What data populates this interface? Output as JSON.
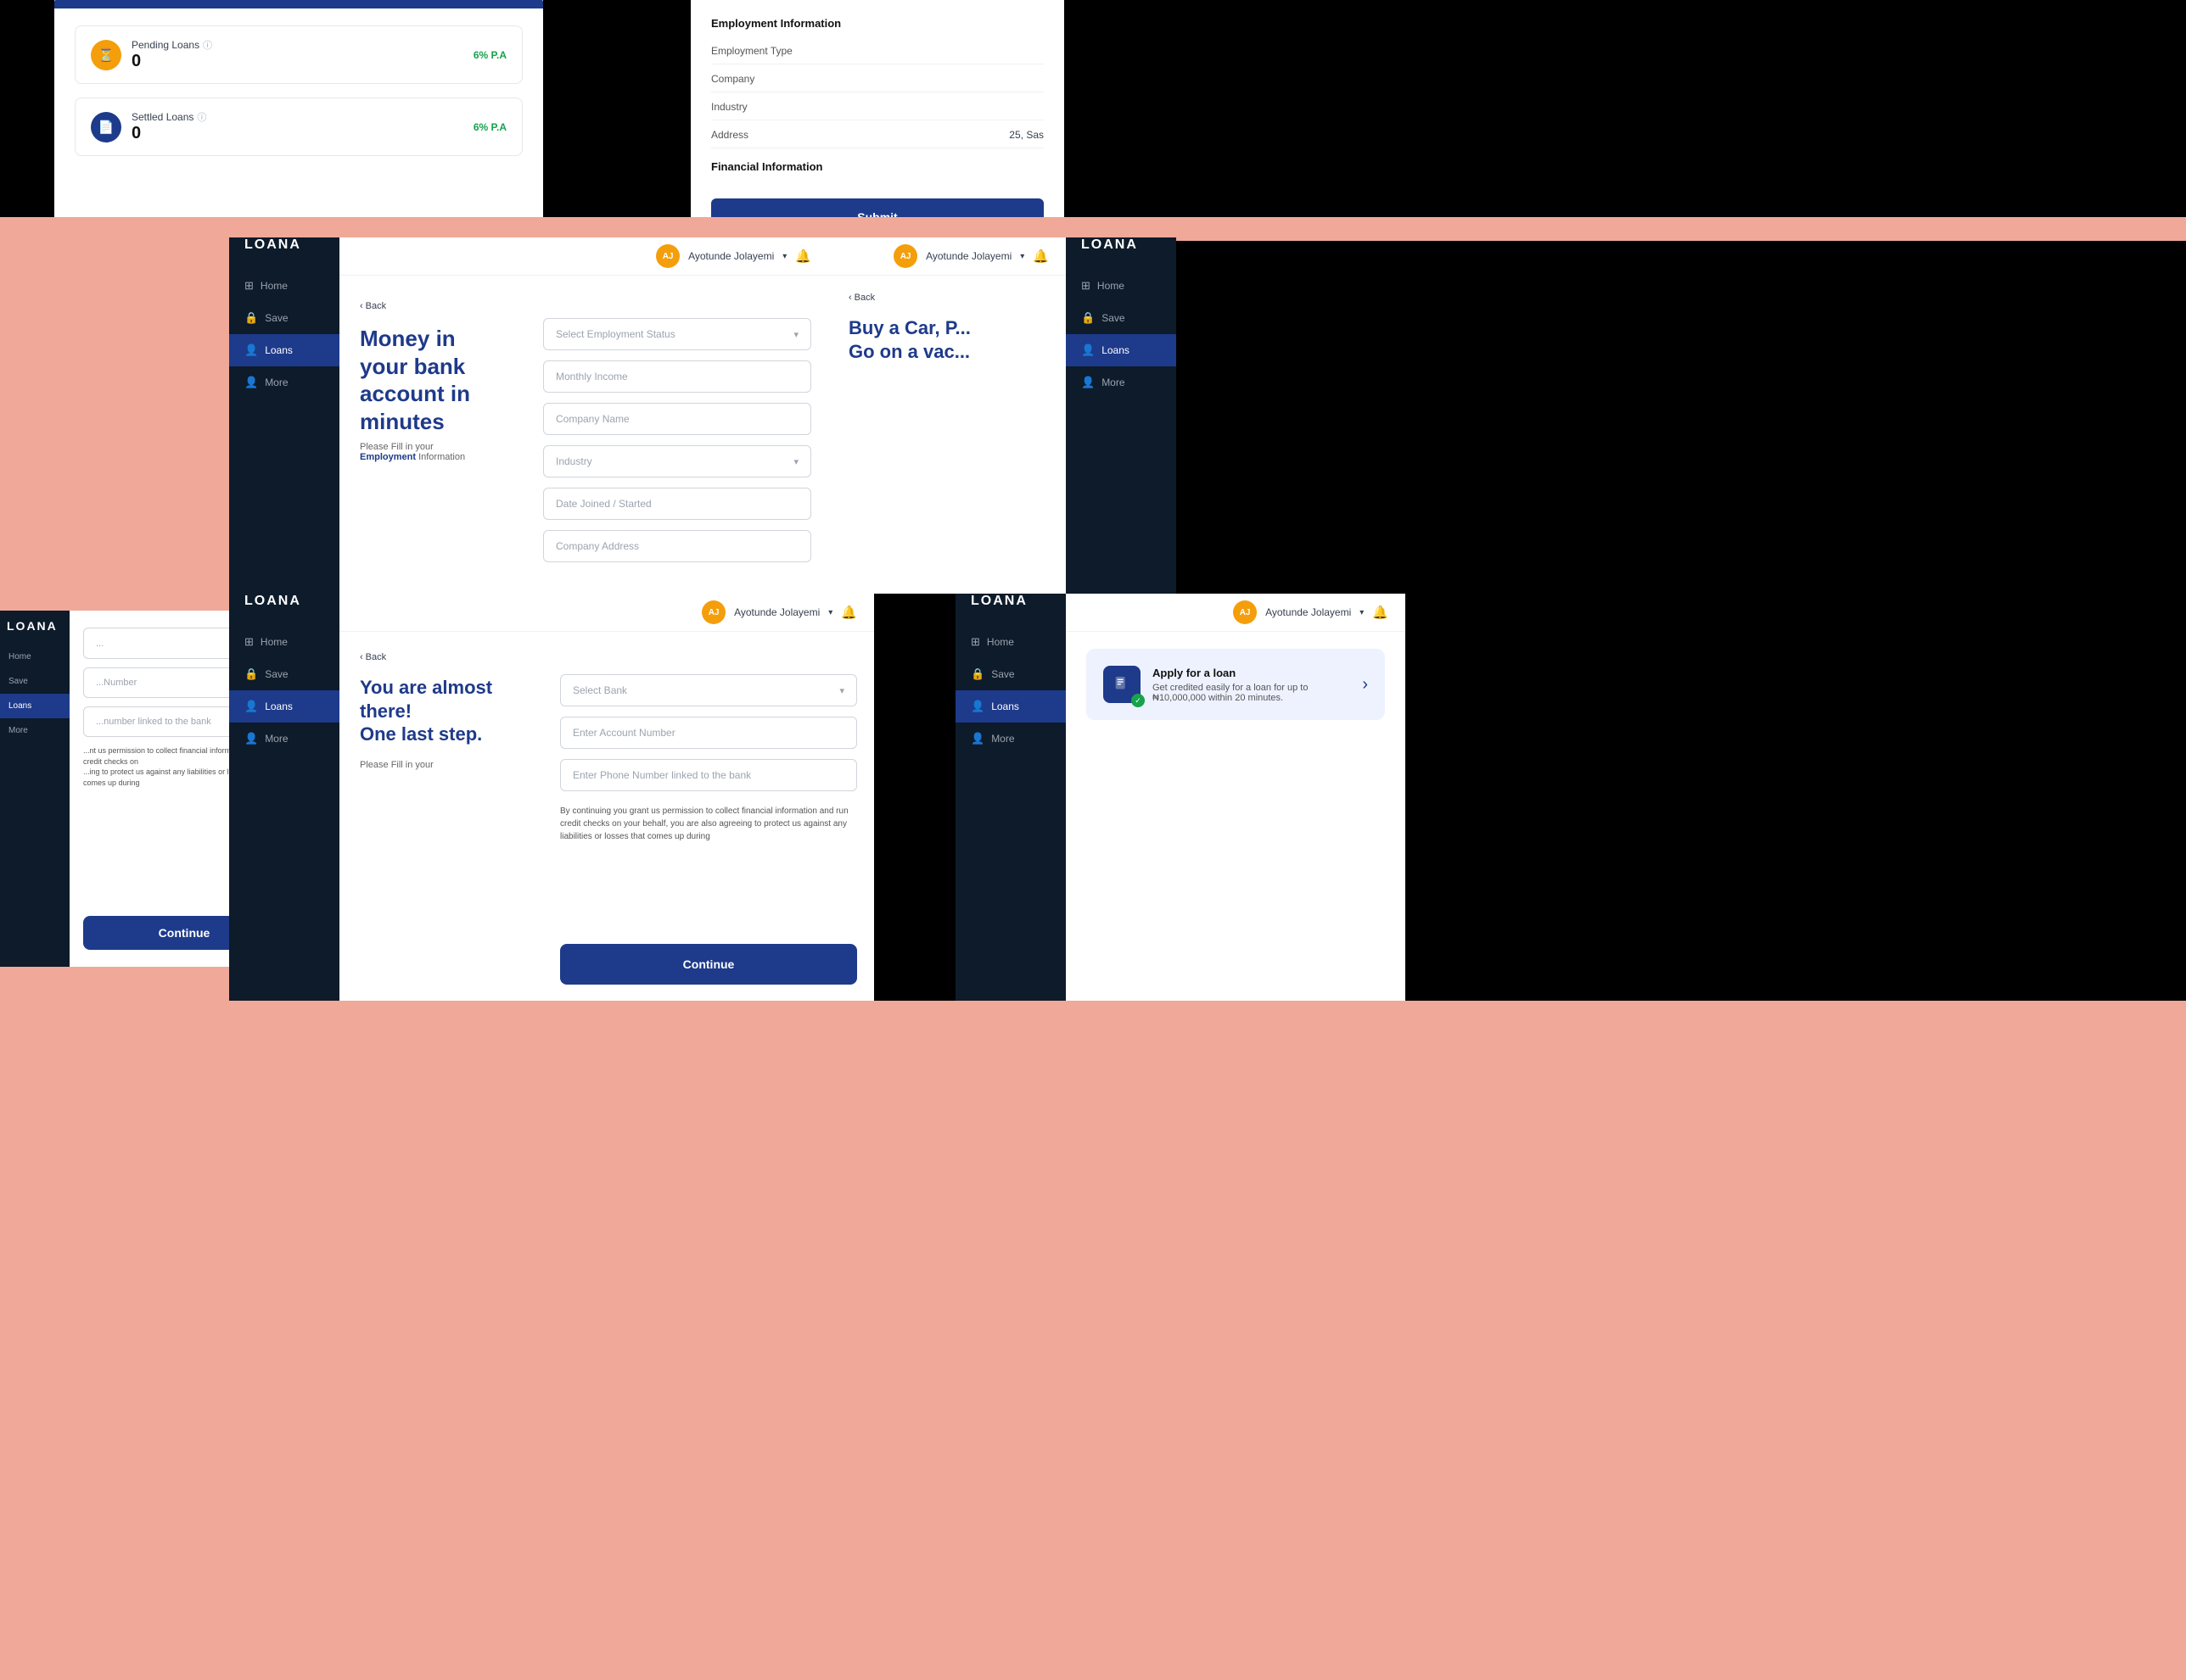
{
  "screens": {
    "screen_a": {
      "loans": [
        {
          "label": "Pending Loans",
          "icon": "⏳",
          "icon_bg": "#F59E0B",
          "count": "0",
          "rate": "6% P.A"
        },
        {
          "label": "Settled Loans",
          "icon": "📄",
          "icon_bg": "#1E3A8A",
          "count": "0",
          "rate": "6% P.A"
        }
      ]
    },
    "screen_b": {
      "employment_section": "Employment Information",
      "fields": [
        {
          "label": "Employment Type",
          "value": ""
        },
        {
          "label": "Company",
          "value": ""
        },
        {
          "label": "Industry",
          "value": ""
        },
        {
          "label": "Address",
          "value": "25, Sas"
        }
      ],
      "financial_section": "Financial Information",
      "submit_label": "Submit"
    },
    "screen_c": {
      "back": "Back",
      "title_line1": "Money in your bank",
      "title_line2": "account in minutes",
      "note_prefix": "Please Fill in your",
      "note_highlight": "Employment",
      "note_suffix": " Information",
      "fields": [
        {
          "type": "select",
          "placeholder": "Select Employment Status"
        },
        {
          "type": "input",
          "placeholder": "Monthly Income"
        },
        {
          "type": "input",
          "placeholder": "Company Name"
        },
        {
          "type": "select",
          "placeholder": "Industry"
        },
        {
          "type": "input",
          "placeholder": "Date Joined / Started"
        },
        {
          "type": "input",
          "placeholder": "Company Address"
        }
      ],
      "nav": {
        "logo": "LOANA",
        "items": [
          {
            "label": "Home",
            "icon": "⊞",
            "active": false
          },
          {
            "label": "Save",
            "icon": "🔒",
            "active": false
          },
          {
            "label": "Loans",
            "icon": "👤",
            "active": true
          },
          {
            "label": "More",
            "icon": "👤",
            "active": false
          }
        ]
      }
    },
    "screen_d": {
      "back": "Back",
      "title": "Buy a Car, P...\nGo on a vac...",
      "nav": {
        "logo": "LOANA",
        "items": [
          {
            "label": "Home",
            "icon": "⊞",
            "active": false
          },
          {
            "label": "Save",
            "icon": "🔒",
            "active": false
          },
          {
            "label": "Loans",
            "icon": "👤",
            "active": true
          },
          {
            "label": "More",
            "icon": "👤",
            "active": false
          }
        ]
      }
    },
    "screen_e": {
      "nav": {
        "items": [
          {
            "label": "LOANA",
            "is_logo": true
          },
          {
            "label": "Home",
            "active": false
          },
          {
            "label": "Save",
            "active": false
          },
          {
            "label": "Loans",
            "active": true
          },
          {
            "label": "More",
            "active": false
          }
        ]
      }
    },
    "screen_f": {
      "back": "Back",
      "title_line1": "You are almost there!",
      "title_line2": "One last step.",
      "note_prefix": "Please Fill in your",
      "fields": [
        {
          "type": "select",
          "placeholder": "Select Bank"
        },
        {
          "type": "input",
          "placeholder": "Enter Account Number"
        },
        {
          "type": "input",
          "placeholder": "Enter Phone Number linked to the bank"
        }
      ],
      "continue_label": "Continue",
      "disclaimer": "By continuing you grant us permission to collect financial information and run credit checks on your behalf, you are also agreeing to protect us against any liabilities or losses that comes up during",
      "nav": {
        "logo": "LOANA",
        "items": [
          {
            "label": "Home",
            "icon": "⊞",
            "active": false
          },
          {
            "label": "Save",
            "icon": "🔒",
            "active": false
          },
          {
            "label": "Loans",
            "icon": "👤",
            "active": true
          },
          {
            "label": "More",
            "icon": "👤",
            "active": false
          }
        ]
      },
      "user": {
        "name": "Ayotunde Jolayemi",
        "initials": "AJ"
      }
    },
    "screen_g": {
      "nav": {
        "logo": "LOANA",
        "items": [
          {
            "label": "Home",
            "icon": "⊞",
            "active": false
          },
          {
            "label": "Save",
            "icon": "🔒",
            "active": false
          },
          {
            "label": "Loans",
            "icon": "👤",
            "active": true
          },
          {
            "label": "More",
            "icon": "👤",
            "active": false
          }
        ]
      },
      "apply_card": {
        "title": "Apply for a loan",
        "description": "Get credited easily for a loan for up to ₦10,000,000 within 20 minutes.",
        "chevron": "›"
      }
    }
  },
  "user": {
    "name": "Ayotunde Jolayemi",
    "initials": "AJ"
  },
  "colors": {
    "brand_dark": "#1E3A8A",
    "sidebar_bg": "#0D1B2A",
    "salmon": "#F0A898",
    "green": "#16A34A",
    "amber": "#F59E0B"
  }
}
